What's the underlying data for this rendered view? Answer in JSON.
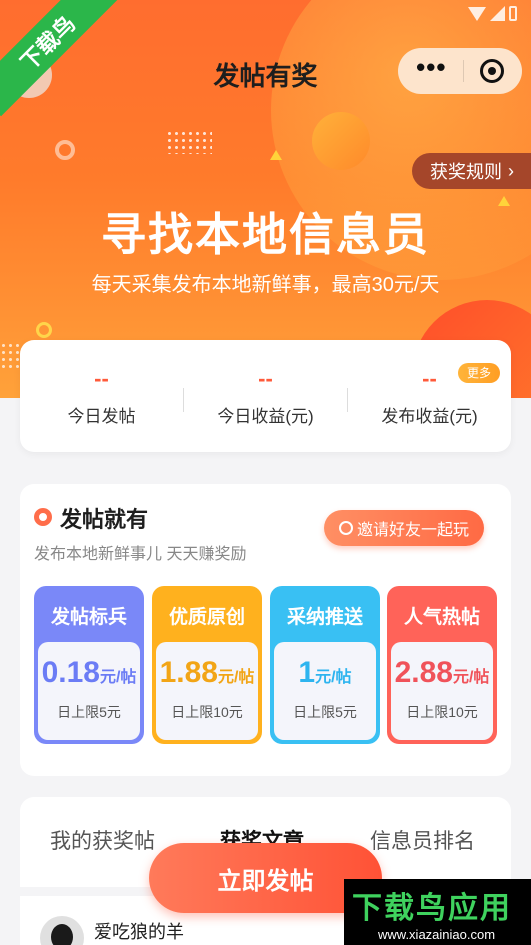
{
  "header": {
    "title": "发帖有奖",
    "back_icon": "chevron-left-icon",
    "menu_icon": "more-dots-icon",
    "close_icon": "target-circle-icon"
  },
  "hero": {
    "rules_label": "获奖规则",
    "title": "寻找本地信息员",
    "subtitle": "每天采集发布本地新鲜事，最高30元/天"
  },
  "stats": {
    "more_badge": "更多",
    "items": [
      {
        "value": "--",
        "label": "今日发帖"
      },
      {
        "value": "--",
        "label": "今日收益(元)"
      },
      {
        "value": "--",
        "label": "发布收益(元)"
      }
    ]
  },
  "post": {
    "title": "发帖就有",
    "subtitle": "发布本地新鲜事儿 天天赚奖励",
    "invite_label": "邀请好友一起玩",
    "rewards": [
      {
        "name": "发帖标兵",
        "amount": "0.18",
        "unit": "元/帖",
        "limit": "日上限5元",
        "color": "#6b7cf5",
        "head": "#7a88f8"
      },
      {
        "name": "优质原创",
        "amount": "1.88",
        "unit": "元/帖",
        "limit": "日上限10元",
        "color": "#f2a516",
        "head": "#ffb11e"
      },
      {
        "name": "采纳推送",
        "amount": "1",
        "unit": "元/帖",
        "limit": "日上限5元",
        "color": "#2db4ef",
        "head": "#39c0f3"
      },
      {
        "name": "人气热帖",
        "amount": "2.88",
        "unit": "元/帖",
        "limit": "日上限10元",
        "color": "#f0525a",
        "head": "#ff6359"
      }
    ]
  },
  "tabs": [
    {
      "label": "我的获奖帖"
    },
    {
      "label": "获奖文章"
    },
    {
      "label": "信息员排名"
    }
  ],
  "publish_label": "立即发帖",
  "feed": {
    "user_name": "爱吃狼的羊"
  },
  "watermarks": {
    "corner": "下载鸟",
    "bottom_title": "下载鸟应用",
    "bottom_url": "www.xiazainiao.com"
  }
}
